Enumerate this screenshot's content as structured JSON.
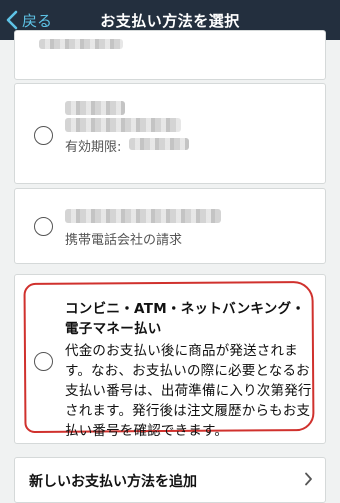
{
  "header": {
    "back_label": "戻る",
    "title": "お支払い方法を選択"
  },
  "payment_options": {
    "card_expiry_label": "有効期限:",
    "carrier_billing_label": "携帯電話会社の請求",
    "convenience": {
      "title": "コンビニ・ATM・ネットバンキング・電子マネー払い",
      "description": "代金のお支払い後に商品が発送されます。なお、お支払いの際に必要となるお支払い番号は、出荷準備に入り次第発行されます。発行後は注文履歴からもお支払い番号を確認できます。"
    }
  },
  "footer": {
    "add_method_label": "新しいお支払い方法を追加"
  },
  "colors": {
    "navbar": "#232f3e",
    "back_link": "#5ec3e6",
    "annotation": "#d0312d"
  }
}
